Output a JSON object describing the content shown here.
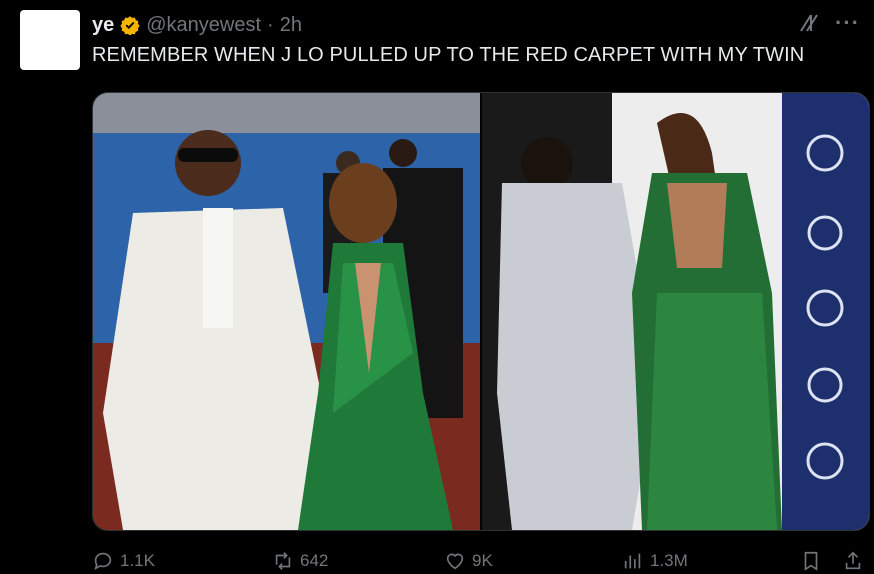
{
  "tweet": {
    "author": {
      "display_name": "ye",
      "handle": "@kanyewest",
      "separator": "·",
      "time": "2h"
    },
    "text": "REMEMBER WHEN J LO PULLED UP TO THE RED CARPET WITH MY TWIN",
    "media_count": 2,
    "stats": {
      "replies": "1.1K",
      "reposts": "642",
      "likes": "9K",
      "views": "1.3M"
    }
  },
  "icons": {
    "verified": "verified-badge-icon",
    "grok": "grok-icon",
    "more": "more-icon",
    "reply": "reply-icon",
    "repost": "repost-icon",
    "like": "heart-icon",
    "views": "views-icon",
    "bookmark": "bookmark-icon",
    "share": "share-icon"
  },
  "colors": {
    "background": "#000000",
    "text": "#e7e9ea",
    "muted": "#71767b",
    "verified": "#f4b400"
  }
}
